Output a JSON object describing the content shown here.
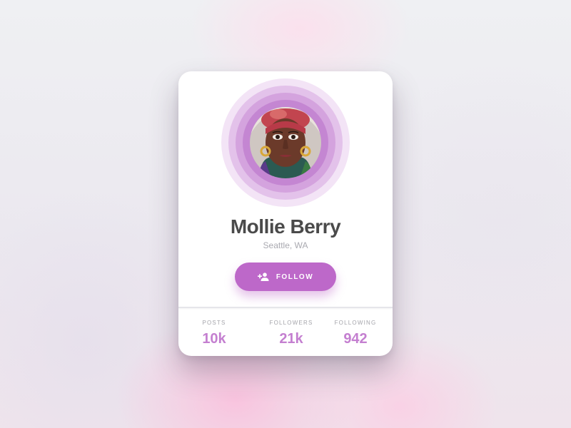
{
  "profile": {
    "name": "Mollie Berry",
    "location": "Seattle, WA",
    "avatar_alt": "profile photo"
  },
  "follow_button": {
    "label": "FOLLOW",
    "icon": "person-add-icon"
  },
  "stats": [
    {
      "label": "POSTS",
      "value": "10k"
    },
    {
      "label": "FOLLOWERS",
      "value": "21k"
    },
    {
      "label": "FOLLOWING",
      "value": "942"
    }
  ],
  "colors": {
    "accent": "#bd68c9",
    "stat_value": "#c47fd0",
    "name_text": "#4a4a4a",
    "muted_text": "#a9a9b0",
    "ring_colors": [
      "#f3e4f6",
      "#e3c2ea",
      "#d4a3de",
      "#c486d2"
    ]
  }
}
